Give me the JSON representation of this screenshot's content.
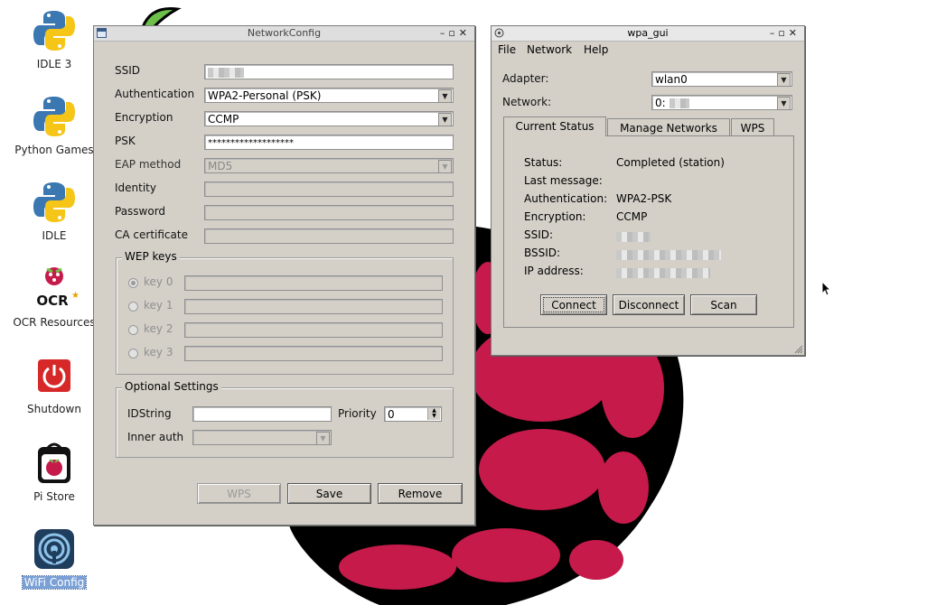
{
  "desktop": {
    "icons": [
      {
        "label": "IDLE 3",
        "icon": "python-icon"
      },
      {
        "label": "Python Games",
        "icon": "python-icon"
      },
      {
        "label": "IDLE",
        "icon": "python-icon"
      },
      {
        "label": "OCR Resources",
        "icon": "ocr-raspberry-icon"
      },
      {
        "label": "Shutdown",
        "icon": "power-icon"
      },
      {
        "label": "Pi Store",
        "icon": "pi-store-icon"
      },
      {
        "label": "WiFi Config",
        "icon": "wifi-icon"
      }
    ]
  },
  "network_config": {
    "title": "NetworkConfig",
    "fields": {
      "ssid": {
        "label": "SSID",
        "value": ""
      },
      "authentication": {
        "label": "Authentication",
        "value": "WPA2-Personal (PSK)"
      },
      "encryption": {
        "label": "Encryption",
        "value": "CCMP"
      },
      "psk": {
        "label": "PSK",
        "value": "*******************"
      },
      "eap_method": {
        "label": "EAP method",
        "value": "MD5"
      },
      "identity": {
        "label": "Identity",
        "value": ""
      },
      "password": {
        "label": "Password",
        "value": ""
      },
      "ca_certificate": {
        "label": "CA certificate",
        "value": ""
      }
    },
    "wep": {
      "title": "WEP keys",
      "keys": [
        "key 0",
        "key 1",
        "key 2",
        "key 3"
      ]
    },
    "optional": {
      "title": "Optional Settings",
      "idstring_label": "IDString",
      "idstring_value": "",
      "priority_label": "Priority",
      "priority_value": "0",
      "inner_auth_label": "Inner auth",
      "inner_auth_value": ""
    },
    "buttons": {
      "wps": "WPS",
      "save": "Save",
      "remove": "Remove"
    }
  },
  "wpa_gui": {
    "title": "wpa_gui",
    "menu": [
      "File",
      "Network",
      "Help"
    ],
    "adapter_label": "Adapter:",
    "adapter_value": "wlan0",
    "network_label": "Network:",
    "network_value": "0:",
    "tabs": [
      "Current Status",
      "Manage Networks",
      "WPS"
    ],
    "status": [
      {
        "key": "Status:",
        "value": "Completed (station)"
      },
      {
        "key": "Last message:",
        "value": ""
      },
      {
        "key": "Authentication:",
        "value": "WPA2-PSK"
      },
      {
        "key": "Encryption:",
        "value": "CCMP"
      },
      {
        "key": "SSID:",
        "value": ""
      },
      {
        "key": "BSSID:",
        "value": ""
      },
      {
        "key": "IP address:",
        "value": ""
      }
    ],
    "buttons": {
      "connect": "Connect",
      "disconnect": "Disconnect",
      "scan": "Scan"
    }
  },
  "colors": {
    "raspberry_red": "#c51a4a",
    "raspberry_leaf": "#6cc04a",
    "window_bg": "#d4d0c8",
    "selection": "#7aa0d6"
  }
}
